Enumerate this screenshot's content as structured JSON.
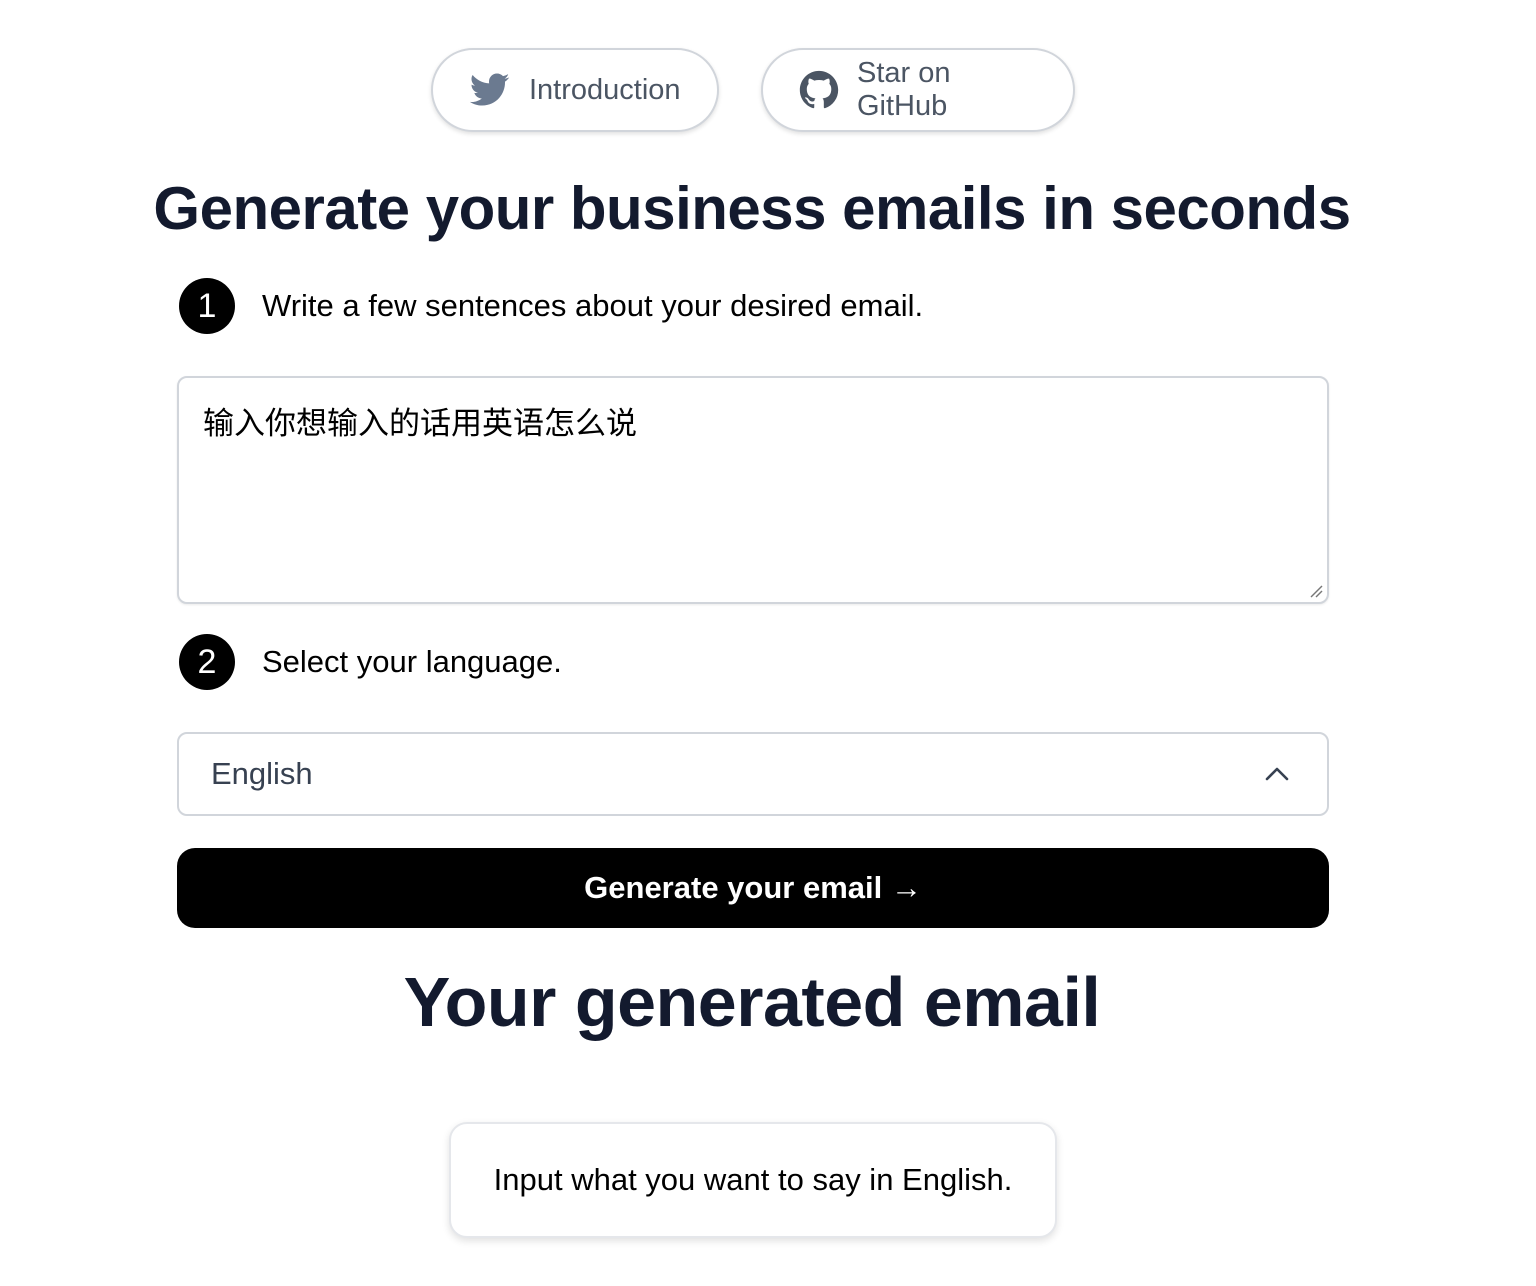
{
  "header": {
    "intro_button": {
      "label": "Introduction",
      "icon": "twitter-icon"
    },
    "github_button": {
      "label": "Star on GitHub",
      "icon": "github-icon"
    }
  },
  "main": {
    "headline": "Generate your business emails in seconds",
    "step1": {
      "number": "1",
      "label": "Write a few sentences about your desired email."
    },
    "textarea": {
      "value": "输入你想输入的话用英语怎么说"
    },
    "step2": {
      "number": "2",
      "label": "Select your language."
    },
    "language_select": {
      "selected": "English",
      "icon": "chevron-up-icon"
    },
    "generate_button": {
      "label": "Generate your email →"
    },
    "result_title": "Your generated email",
    "result_card": {
      "text": "Input what you want to say in English."
    }
  },
  "colors": {
    "heading": "#131a2e",
    "button_bg": "#000000",
    "border": "#d1d5db",
    "pill_text": "#4b5563"
  }
}
